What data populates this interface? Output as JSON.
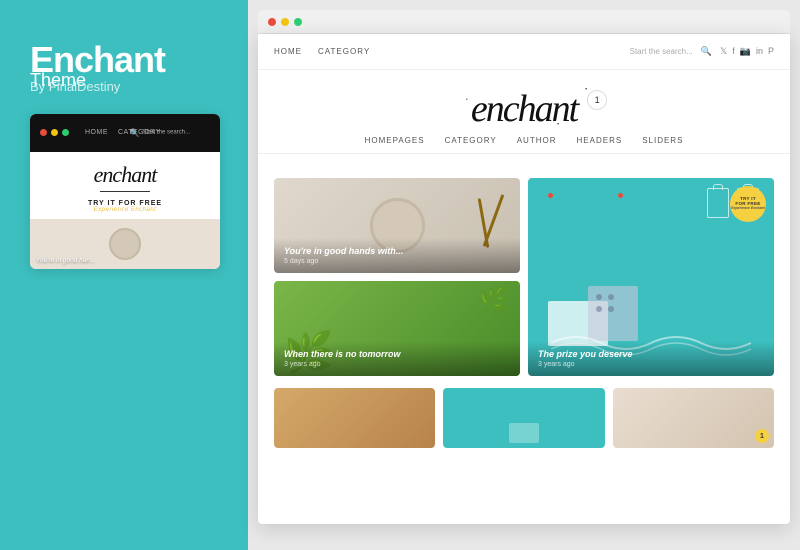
{
  "sidebar": {
    "title": "Enchant",
    "subtitle": "Theme",
    "author": "By FinalDestiny",
    "mini_preview": {
      "nav_links": [
        "HOME",
        "CATEGORY"
      ],
      "search_placeholder": "Start the search...",
      "logo": "enchant",
      "cta_main": "TRY IT FOR FREE",
      "cta_sub": "Experience Enchant",
      "card_text": "You're in good han..."
    }
  },
  "browser": {
    "dots": [
      "red",
      "yellow",
      "green"
    ]
  },
  "site": {
    "nav_links": [
      "HOME",
      "CATEGORY"
    ],
    "search_placeholder": "Start the search...",
    "social_icons": [
      "twitter",
      "facebook",
      "instagram",
      "linkedin",
      "pinterest"
    ],
    "logo": "enchant",
    "notification_count": "1",
    "secondary_nav": [
      "HOMEPAGES",
      "CATEGORY",
      "AUTHOR",
      "HEADERS",
      "SLIDERS"
    ],
    "cards": [
      {
        "title": "You're in good hands with...",
        "time": "5 days ago",
        "bg": "plate"
      },
      {
        "title": "The prize you deserve",
        "time": "3 years ago",
        "bg": "teal",
        "badge_text": "TRY IT FOR FREE",
        "badge_sub": "Experience Enchant"
      },
      {
        "title": "When there is no tomorrow",
        "time": "3 years ago",
        "bg": "plant"
      }
    ],
    "bottom_cards": [
      {
        "bg": "wood"
      },
      {
        "bg": "teal2"
      },
      {
        "bg": "warm",
        "badge": "1"
      }
    ]
  }
}
